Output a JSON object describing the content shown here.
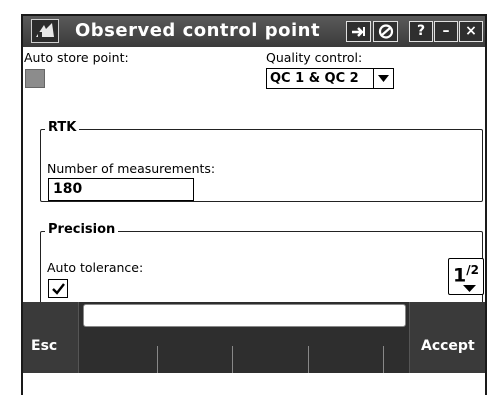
{
  "window": {
    "title": "Observed control point",
    "buttons": {
      "help": "?",
      "minimize": "–",
      "close": "×"
    }
  },
  "form": {
    "auto_store_label": "Auto store point:",
    "auto_store_checked": false,
    "quality_control_label": "Quality control:",
    "quality_control_value": "QC 1 & QC 2",
    "rtk_group_title": "RTK",
    "num_measurements_label": "Number of measurements:",
    "num_measurements_value": "180",
    "precision_group_title": "Precision",
    "auto_tolerance_label": "Auto tolerance:",
    "auto_tolerance_checked": true
  },
  "pager": {
    "current": "1",
    "total": "2"
  },
  "softkeys": {
    "esc": "Esc",
    "accept": "Accept"
  }
}
